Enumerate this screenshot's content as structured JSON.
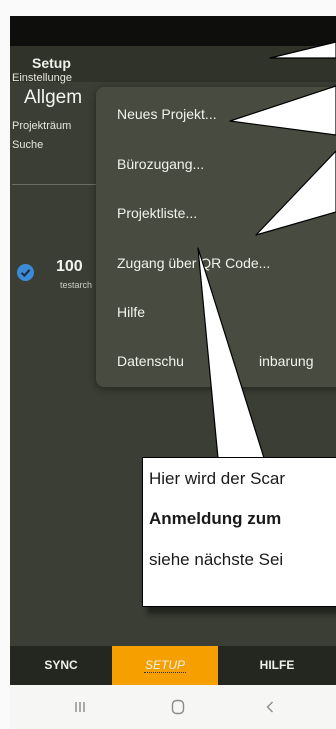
{
  "app": {
    "title": "Setup",
    "settings_label": "Einstellunge",
    "section_heading": "Allgem",
    "project_rooms_label": "Projekträum",
    "search_label": "Suche",
    "project_number": "100",
    "project_sub": "testarch"
  },
  "menu": {
    "items": [
      {
        "label": "Neues Projekt..."
      },
      {
        "label": "Bürozugang..."
      },
      {
        "label": "Projektliste..."
      },
      {
        "label": "Zugang über QR Code..."
      },
      {
        "label": "Hilfe"
      },
      {
        "label": "Datenschu"
      },
      {
        "label": "inbarung"
      }
    ]
  },
  "callout": {
    "line1": "Hier wird der Scar",
    "line2_bold": "Anmeldung zum",
    "line3": "siehe nächste Sei"
  },
  "tabs": {
    "sync": "SYNC",
    "setup": "SETUP",
    "hilfe": "HILFE"
  },
  "nav": {
    "recent_icon": "recents-icon",
    "home_icon": "home-icon",
    "back_icon": "back-icon"
  },
  "colors": {
    "accent": "#f5a000",
    "menu_bg": "#484c40",
    "app_bg": "#3a3e34",
    "check": "#3b8bd9"
  }
}
